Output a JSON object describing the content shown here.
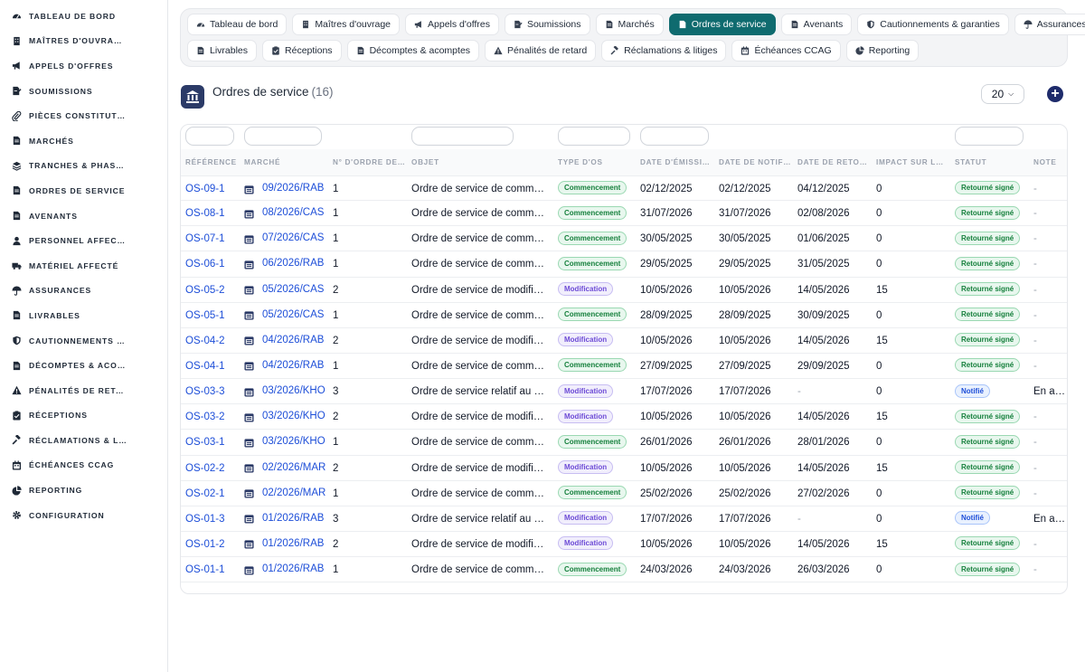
{
  "sidebar": {
    "items": [
      {
        "label": "TABLEAU DE BORD",
        "icon": "dashboard-icon"
      },
      {
        "label": "MAÎTRES D'OUVRAGE",
        "icon": "building-icon"
      },
      {
        "label": "APPELS D'OFFRES",
        "icon": "megaphone-icon"
      },
      {
        "label": "SOUMISSIONS",
        "icon": "file-signature-icon"
      },
      {
        "label": "PIÈCES CONSTITUTIV…",
        "icon": "paperclip-icon"
      },
      {
        "label": "MARCHÉS",
        "icon": "document-icon"
      },
      {
        "label": "TRANCHES & PHASES",
        "icon": "layers-icon"
      },
      {
        "label": "ORDRES DE SERVICE",
        "icon": "document-icon"
      },
      {
        "label": "AVENANTS",
        "icon": "document-icon"
      },
      {
        "label": "PERSONNEL AFFECTÉ",
        "icon": "user-icon"
      },
      {
        "label": "MATÉRIEL AFFECTÉ",
        "icon": "truck-icon"
      },
      {
        "label": "ASSURANCES",
        "icon": "umbrella-icon"
      },
      {
        "label": "LIVRABLES",
        "icon": "document-icon"
      },
      {
        "label": "CAUTIONNEMENTS & …",
        "icon": "shield-icon"
      },
      {
        "label": "DÉCOMPTES & ACOM…",
        "icon": "document-icon"
      },
      {
        "label": "PÉNALITÉS DE RETARD",
        "icon": "warning-icon"
      },
      {
        "label": "RÉCEPTIONS",
        "icon": "clipboard-check-icon"
      },
      {
        "label": "RÉCLAMATIONS & LIT…",
        "icon": "gavel-icon"
      },
      {
        "label": "ÉCHÉANCES CCAG",
        "icon": "calendar-icon"
      },
      {
        "label": "REPORTING",
        "icon": "chart-pie-icon"
      },
      {
        "label": "CONFIGURATION",
        "icon": "gear-icon"
      }
    ]
  },
  "tabs": {
    "row1": [
      {
        "label": "Tableau de bord",
        "icon": "dashboard-icon"
      },
      {
        "label": "Maîtres d'ouvrage",
        "icon": "building-icon"
      },
      {
        "label": "Appels d'offres",
        "icon": "megaphone-icon"
      },
      {
        "label": "Soumissions",
        "icon": "file-signature-icon"
      },
      {
        "label": "Marchés",
        "icon": "document-icon"
      },
      {
        "label": "Ordres de service",
        "icon": "document-icon",
        "active": true
      },
      {
        "label": "Avenants",
        "icon": "document-icon"
      },
      {
        "label": "Cautionnements & garanties",
        "icon": "shield-icon"
      },
      {
        "label": "Assurances",
        "icon": "umbrella-icon"
      }
    ],
    "row2": [
      {
        "label": "Livrables",
        "icon": "document-icon"
      },
      {
        "label": "Réceptions",
        "icon": "clipboard-check-icon"
      },
      {
        "label": "Décomptes & acomptes",
        "icon": "document-icon"
      },
      {
        "label": "Pénalités de retard",
        "icon": "warning-icon"
      },
      {
        "label": "Réclamations & litiges",
        "icon": "gavel-icon"
      },
      {
        "label": "Échéances CCAG",
        "icon": "calendar-icon"
      },
      {
        "label": "Reporting",
        "icon": "chart-pie-icon"
      }
    ]
  },
  "header": {
    "title": "Ordres de service",
    "count": "(16)",
    "per_page": "20",
    "icon": "bank-icon"
  },
  "colors": {
    "accent": "#0f6b6f",
    "link": "#1d4ed8",
    "add_button": "#1e2b6b",
    "header_icon_bg": "#2b3a67"
  },
  "table": {
    "columns": [
      "RÉFÉRENCE",
      "MARCHÉ",
      "N° D'ORDRE DE…",
      "OBJET",
      "TYPE D'OS",
      "DATE D'ÉMISSI…",
      "DATE DE NOTIF…",
      "DATE DE RETO…",
      "IMPACT SUR LE…",
      "STATUT",
      "NOTE"
    ],
    "rows": [
      {
        "ref": "OS-09-1",
        "marche": "09/2026/RAB",
        "ordre": "1",
        "objet": "Ordre de service de commencement",
        "type": "Commencement",
        "emission": "02/12/2025",
        "notif": "02/12/2025",
        "retour": "04/12/2025",
        "impact": "0",
        "statut": "Retourné signé",
        "note": "-"
      },
      {
        "ref": "OS-08-1",
        "marche": "08/2026/CAS",
        "ordre": "1",
        "objet": "Ordre de service de commencement",
        "type": "Commencement",
        "emission": "31/07/2026",
        "notif": "31/07/2026",
        "retour": "02/08/2026",
        "impact": "0",
        "statut": "Retourné signé",
        "note": "-"
      },
      {
        "ref": "OS-07-1",
        "marche": "07/2026/CAS",
        "ordre": "1",
        "objet": "Ordre de service de commencement",
        "type": "Commencement",
        "emission": "30/05/2025",
        "notif": "30/05/2025",
        "retour": "01/06/2025",
        "impact": "0",
        "statut": "Retourné signé",
        "note": "-"
      },
      {
        "ref": "OS-06-1",
        "marche": "06/2026/RAB",
        "ordre": "1",
        "objet": "Ordre de service de commencement",
        "type": "Commencement",
        "emission": "29/05/2025",
        "notif": "29/05/2025",
        "retour": "31/05/2025",
        "impact": "0",
        "statut": "Retourné signé",
        "note": "-"
      },
      {
        "ref": "OS-05-2",
        "marche": "05/2026/CAS",
        "ordre": "2",
        "objet": "Ordre de service de modification",
        "type": "Modification",
        "emission": "10/05/2026",
        "notif": "10/05/2026",
        "retour": "14/05/2026",
        "impact": "15",
        "statut": "Retourné signé",
        "note": "-"
      },
      {
        "ref": "OS-05-1",
        "marche": "05/2026/CAS",
        "ordre": "1",
        "objet": "Ordre de service de commencement",
        "type": "Commencement",
        "emission": "28/09/2025",
        "notif": "28/09/2025",
        "retour": "30/09/2025",
        "impact": "0",
        "statut": "Retourné signé",
        "note": "-"
      },
      {
        "ref": "OS-04-2",
        "marche": "04/2026/RAB",
        "ordre": "2",
        "objet": "Ordre de service de modification",
        "type": "Modification",
        "emission": "10/05/2026",
        "notif": "10/05/2026",
        "retour": "14/05/2026",
        "impact": "15",
        "statut": "Retourné signé",
        "note": "-"
      },
      {
        "ref": "OS-04-1",
        "marche": "04/2026/RAB",
        "ordre": "1",
        "objet": "Ordre de service de commencement",
        "type": "Commencement",
        "emission": "27/09/2025",
        "notif": "27/09/2025",
        "retour": "29/09/2025",
        "impact": "0",
        "statut": "Retourné signé",
        "note": "-"
      },
      {
        "ref": "OS-03-3",
        "marche": "03/2026/KHO",
        "ordre": "3",
        "objet": "Ordre de service relatif au planning",
        "type": "Modification",
        "emission": "17/07/2026",
        "notif": "17/07/2026",
        "retour": "-",
        "impact": "0",
        "statut": "Notifié",
        "note": "En attente"
      },
      {
        "ref": "OS-03-2",
        "marche": "03/2026/KHO",
        "ordre": "2",
        "objet": "Ordre de service de modification",
        "type": "Modification",
        "emission": "10/05/2026",
        "notif": "10/05/2026",
        "retour": "14/05/2026",
        "impact": "15",
        "statut": "Retourné signé",
        "note": "-"
      },
      {
        "ref": "OS-03-1",
        "marche": "03/2026/KHO",
        "ordre": "1",
        "objet": "Ordre de service de commencement",
        "type": "Commencement",
        "emission": "26/01/2026",
        "notif": "26/01/2026",
        "retour": "28/01/2026",
        "impact": "0",
        "statut": "Retourné signé",
        "note": "-"
      },
      {
        "ref": "OS-02-2",
        "marche": "02/2026/MAR",
        "ordre": "2",
        "objet": "Ordre de service de modification",
        "type": "Modification",
        "emission": "10/05/2026",
        "notif": "10/05/2026",
        "retour": "14/05/2026",
        "impact": "15",
        "statut": "Retourné signé",
        "note": "-"
      },
      {
        "ref": "OS-02-1",
        "marche": "02/2026/MAR",
        "ordre": "1",
        "objet": "Ordre de service de commencement",
        "type": "Commencement",
        "emission": "25/02/2026",
        "notif": "25/02/2026",
        "retour": "27/02/2026",
        "impact": "0",
        "statut": "Retourné signé",
        "note": "-"
      },
      {
        "ref": "OS-01-3",
        "marche": "01/2026/RAB",
        "ordre": "3",
        "objet": "Ordre de service relatif au planning",
        "type": "Modification",
        "emission": "17/07/2026",
        "notif": "17/07/2026",
        "retour": "-",
        "impact": "0",
        "statut": "Notifié",
        "note": "En attente"
      },
      {
        "ref": "OS-01-2",
        "marche": "01/2026/RAB",
        "ordre": "2",
        "objet": "Ordre de service de modification",
        "type": "Modification",
        "emission": "10/05/2026",
        "notif": "10/05/2026",
        "retour": "14/05/2026",
        "impact": "15",
        "statut": "Retourné signé",
        "note": "-"
      },
      {
        "ref": "OS-01-1",
        "marche": "01/2026/RAB",
        "ordre": "1",
        "objet": "Ordre de service de commencement",
        "type": "Commencement",
        "emission": "24/03/2026",
        "notif": "24/03/2026",
        "retour": "26/03/2026",
        "impact": "0",
        "statut": "Retourné signé",
        "note": "-"
      }
    ]
  }
}
